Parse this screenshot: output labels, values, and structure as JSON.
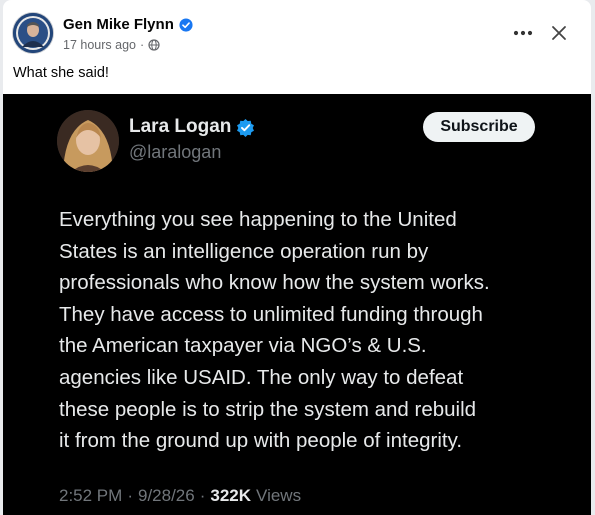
{
  "post": {
    "author_name": "Gen Mike Flynn",
    "timestamp": "17 hours ago",
    "meta_separator": "·",
    "visibility_icon": "globe-icon",
    "more_icon": "more-options-icon",
    "close_icon": "close-icon",
    "text": "What she said!"
  },
  "tweet": {
    "name": "Lara Logan",
    "handle": "@laralogan",
    "subscribe_label": "Subscribe",
    "body_lines": [
      "Everything you see happening to the United",
      "States is an intelligence operation run by",
      "professionals who know how the system works.",
      "They have access to unlimited funding through",
      "the American taxpayer via NGO’s & U.S.",
      "agencies  like USAID. The only way to defeat",
      "these people is to strip the system and rebuild",
      "it from the ground up with people of integrity."
    ],
    "time": "2:52 PM",
    "date": "9/28/26",
    "separator": "·",
    "views_count": "322K",
    "views_label": "Views"
  },
  "colors": {
    "verified_blue": "#1d9bf0",
    "tweet_background": "#000000",
    "muted_text": "#71767b"
  }
}
